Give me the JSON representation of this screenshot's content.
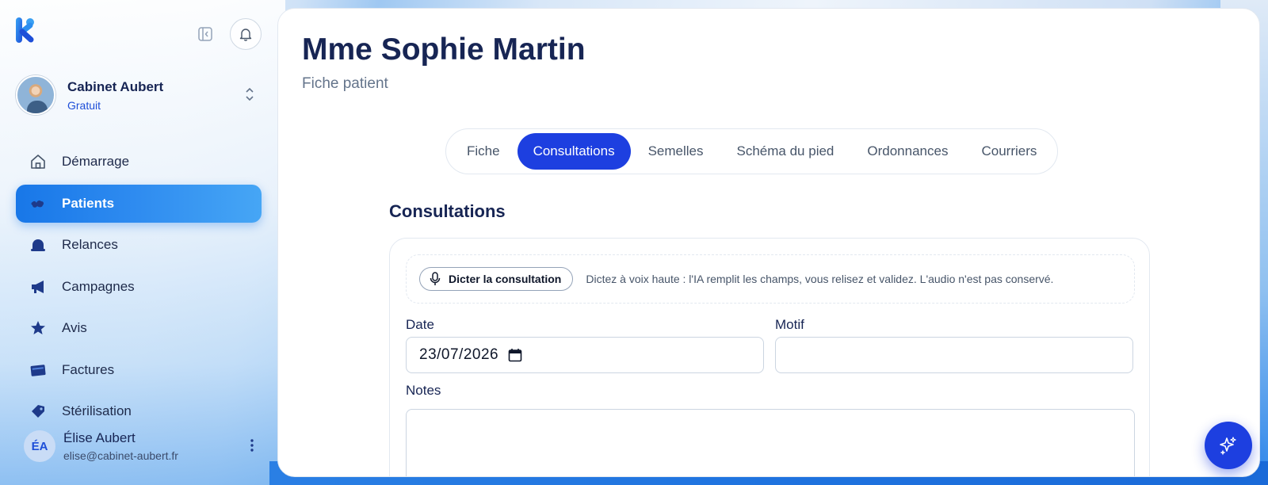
{
  "app": {
    "logo": "k-logo-icon",
    "brand_color": "#1d3fe0"
  },
  "account": {
    "name": "Cabinet Aubert",
    "plan": "Gratuit"
  },
  "sidebar": {
    "items": [
      {
        "label": "Démarrage",
        "icon": "home-icon",
        "active": false
      },
      {
        "label": "Patients",
        "icon": "patients-icon",
        "active": true
      },
      {
        "label": "Relances",
        "icon": "bell-icon",
        "active": false
      },
      {
        "label": "Campagnes",
        "icon": "megaphone-icon",
        "active": false
      },
      {
        "label": "Avis",
        "icon": "star-icon",
        "active": false
      },
      {
        "label": "Factures",
        "icon": "invoice-icon",
        "active": false
      },
      {
        "label": "Stérilisation",
        "icon": "tag-icon",
        "active": false
      }
    ]
  },
  "user": {
    "initials": "ÉA",
    "name": "Élise Aubert",
    "email": "elise@cabinet-aubert.fr"
  },
  "header": {
    "title": "Mme Sophie Martin",
    "subtitle": "Fiche patient"
  },
  "tabs": [
    {
      "label": "Fiche",
      "active": false
    },
    {
      "label": "Consultations",
      "active": true
    },
    {
      "label": "Semelles",
      "active": false
    },
    {
      "label": "Schéma du pied",
      "active": false
    },
    {
      "label": "Ordonnances",
      "active": false
    },
    {
      "label": "Courriers",
      "active": false
    }
  ],
  "consultations": {
    "title": "Consultations",
    "dictate_button": "Dicter la consultation",
    "dictate_hint": "Dictez à voix haute : l'IA remplit les champs, vous relisez et validez. L'audio n'est pas conservé.",
    "date_label": "Date",
    "date_value": "23/07/2026",
    "motif_label": "Motif",
    "motif_value": "",
    "notes_label": "Notes",
    "notes_value": ""
  }
}
